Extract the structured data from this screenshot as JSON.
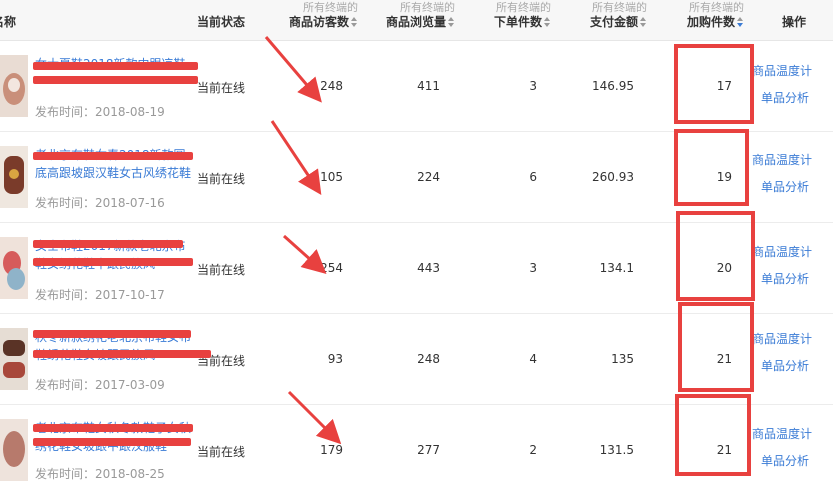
{
  "header": {
    "col_name": "名称",
    "col_status": "当前状态",
    "sub_label": "所有终端的",
    "col_visitors": "商品访客数",
    "col_views": "商品浏览量",
    "col_orders": "下单件数",
    "col_amount": "支付金额",
    "col_cart": "加购件数",
    "col_ops": "操作"
  },
  "rows": [
    {
      "title": "女士夏鞋2018新款中跟凉鞋",
      "date": "发布时间：2018-08-19",
      "status": "当前在线",
      "visitors": "248",
      "views": "411",
      "orders": "3",
      "amount": "146.95",
      "cart": "17",
      "op1": "商品温度计",
      "op2": "单品分析"
    },
    {
      "title": "老北京布鞋女春2018新款圆底高跟坡跟汉鞋女古风绣花鞋",
      "date": "发布时间：2018-07-16",
      "status": "当前在线",
      "visitors": "105",
      "views": "224",
      "orders": "6",
      "amount": "260.93",
      "cart": "19",
      "op1": "商品温度计",
      "op2": "单品分析"
    },
    {
      "title": "女士布鞋2017新款老北京布鞋女绣花鞋中跟民族风",
      "date": "发布时间：2017-10-17",
      "status": "当前在线",
      "visitors": "254",
      "views": "443",
      "orders": "3",
      "amount": "134.1",
      "cart": "20",
      "op1": "商品温度计",
      "op2": "单品分析"
    },
    {
      "title": "秋冬新款绣花老北京布鞋女布鞋绣花鞋女坡跟民族风",
      "date": "发布时间：2017-03-09",
      "status": "当前在线",
      "visitors": "93",
      "views": "248",
      "orders": "4",
      "amount": "135",
      "cart": "21",
      "op1": "商品温度计",
      "op2": "单品分析"
    },
    {
      "title": "老北京布鞋女秋冬款鞋子女秋绣花鞋女坡跟中跟汉服鞋",
      "date": "发布时间：2018-08-25",
      "status": "当前在线",
      "visitors": "179",
      "views": "277",
      "orders": "2",
      "amount": "131.5",
      "cart": "21",
      "op1": "商品温度计",
      "op2": "单品分析"
    }
  ]
}
